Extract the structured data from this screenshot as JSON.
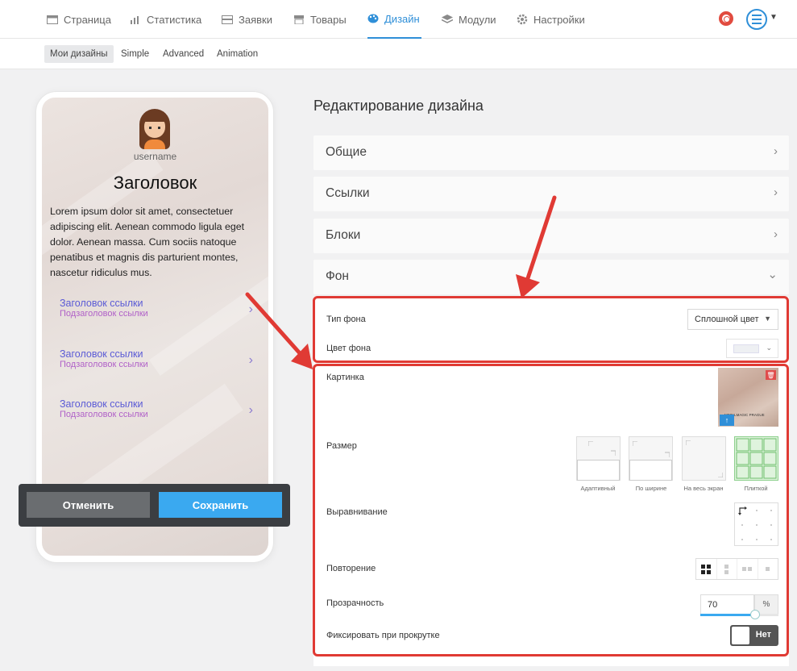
{
  "nav": {
    "items": [
      {
        "label": "Страница",
        "icon": "page-icon"
      },
      {
        "label": "Статистика",
        "icon": "chart-icon"
      },
      {
        "label": "Заявки",
        "icon": "inbox-icon"
      },
      {
        "label": "Товары",
        "icon": "shop-icon"
      },
      {
        "label": "Дизайн",
        "icon": "palette-icon",
        "active": true
      },
      {
        "label": "Модули",
        "icon": "layers-icon"
      },
      {
        "label": "Настройки",
        "icon": "gear-icon"
      }
    ]
  },
  "subnav": {
    "items": [
      {
        "label": "Мои дизайны",
        "active": true
      },
      {
        "label": "Simple"
      },
      {
        "label": "Advanced"
      },
      {
        "label": "Animation"
      }
    ]
  },
  "preview": {
    "username": "username",
    "title": "Заголовок",
    "body": "Lorem ipsum dolor sit amet, consectetuer adipiscing elit. Aenean commodo ligula eget dolor. Aenean massa. Cum sociis natoque penatibus et magnis dis parturient montes, nascetur ridiculus mus.",
    "links": [
      {
        "title": "Заголовок ссылки",
        "subtitle": "Подзаголовок ссылки"
      },
      {
        "title": "Заголовок ссылки",
        "subtitle": "Подзаголовок ссылки"
      },
      {
        "title": "Заголовок ссылки",
        "subtitle": "Подзаголовок ссылки"
      }
    ]
  },
  "actions": {
    "cancel": "Отменить",
    "save": "Сохранить"
  },
  "editor": {
    "title": "Редактирование дизайна",
    "sections": [
      "Общие",
      "Ссылки",
      "Блоки",
      "Фон"
    ],
    "background": {
      "type_label": "Тип фона",
      "type_value": "Сплошной цвет",
      "color_label": "Цвет фона",
      "color_value": "#eef0f3",
      "image_label": "Картинка",
      "image_caption": "METALMAGIC PRAGUE",
      "size_label": "Размер",
      "size_options": [
        "Адаптивный",
        "По ширине",
        "На весь экран",
        "Плиткой"
      ],
      "size_selected": "Плиткой",
      "align_label": "Выравнивание",
      "repeat_label": "Повторение",
      "opacity_label": "Прозрачность",
      "opacity_value": "70",
      "opacity_unit": "%",
      "opacity_fraction": 0.7,
      "fixed_label": "Фиксировать при прокрутке",
      "fixed_value": "Нет"
    }
  },
  "colors": {
    "accent": "#2f8fd8",
    "save": "#3aa9f0",
    "highlight": "#e03a34"
  }
}
